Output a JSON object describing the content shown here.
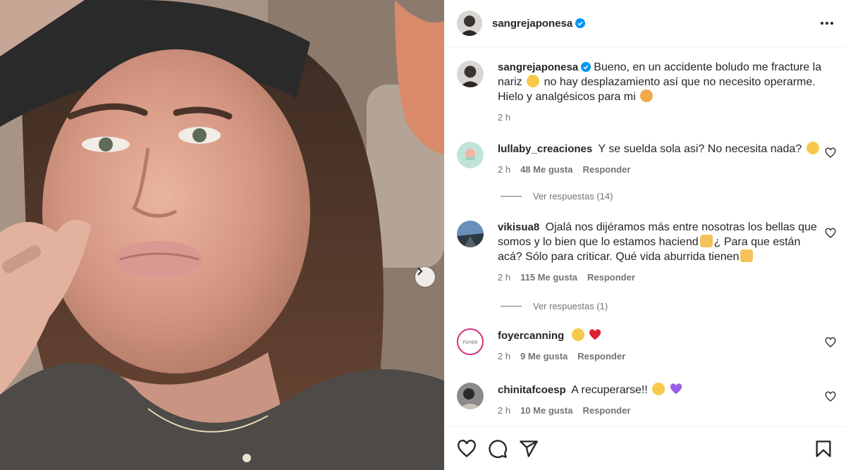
{
  "post": {
    "username": "sangrejaponesa",
    "caption": "Bueno, en un accidente boludo me fracture la nariz",
    "caption_b": "no hay desplazamiento así que no necesito operarme. Hielo y analgésicos para mi",
    "time": "2 h"
  },
  "comments": [
    {
      "username": "lullaby_creaciones",
      "text": "Y se suelda sola asi? No necesita nada?",
      "time": "2 h",
      "likes": "48 Me gusta",
      "reply": "Responder",
      "replies": "Ver respuestas (14)",
      "avatar_color": "#bfe4d7"
    },
    {
      "username": "vikisua8",
      "text": "Ojalá nos dijéramos más entre nosotras los bellas que somos y lo bien que lo estamos haciend",
      "text_b": "¿ Para que están acá? Sólo para criticar. Qué vida aburrida tienen",
      "time": "2 h",
      "likes": "115 Me gusta",
      "reply": "Responder",
      "replies": "Ver respuestas (1)",
      "avatar_color": "#5b7ea6"
    },
    {
      "username": "foyercanning",
      "text": "",
      "time": "2 h",
      "likes": "9 Me gusta",
      "reply": "Responder",
      "avatar_text": "FOYER",
      "avatar_color": "#ffffff"
    },
    {
      "username": "chinitafcoesp",
      "text": "A recuperarse!!",
      "time": "2 h",
      "likes": "10 Me gusta",
      "reply": "Responder",
      "avatar_color": "#6d6d6d"
    }
  ],
  "icons": {
    "like": "heart-icon",
    "comment": "comment-icon",
    "share": "share-icon",
    "save": "bookmark-icon",
    "more": "more-options-icon",
    "verified": "verified-badge-icon",
    "next": "chevron-right-icon"
  },
  "colors": {
    "verified": "#0095f6",
    "text": "#262626",
    "secondary": "#737373"
  }
}
